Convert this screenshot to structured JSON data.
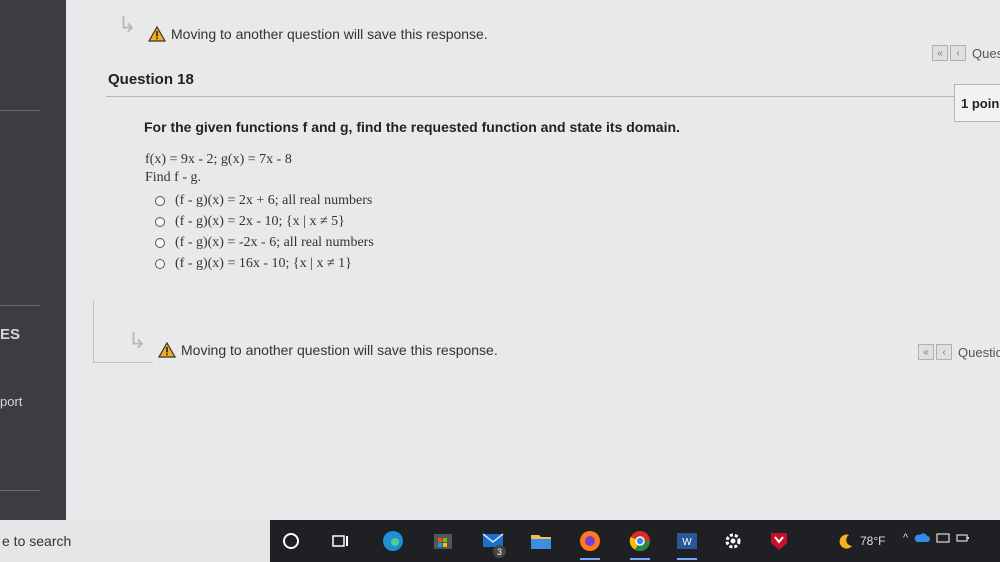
{
  "sidebar": {
    "label_es": "ES",
    "label_port": "port"
  },
  "top_notice": {
    "text": "Moving to another question will save this response."
  },
  "top_nav": {
    "label": "Ques"
  },
  "question": {
    "title": "Question 18",
    "points": "1 poin",
    "prompt": "For the given functions f and g, find the requested function and state its domain.",
    "functions": "f(x) = 9x - 2; g(x) = 7x - 8",
    "find": "Find f - g.",
    "choices": [
      "(f - g)(x) = 2x + 6; all real numbers",
      "(f - g)(x) = 2x - 10; {x | x ≠ 5}",
      "(f - g)(x) = -2x - 6; all real numbers",
      "(f - g)(x) = 16x - 10; {x | x ≠ 1}"
    ]
  },
  "bottom_notice": {
    "text": "Moving to another question will save this response."
  },
  "bottom_nav": {
    "label": "Questio"
  },
  "taskbar": {
    "search_text": "e to search",
    "mail_badge": "3",
    "weather": "78°F",
    "accent": "#7aa7ff"
  }
}
